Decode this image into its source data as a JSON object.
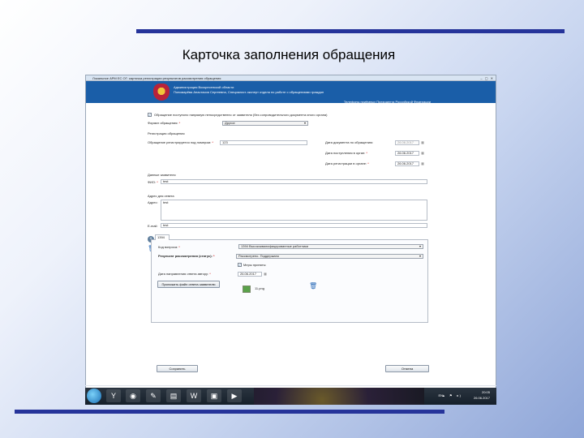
{
  "slide": {
    "title": "Карточка заполнения обращения"
  },
  "window": {
    "title": "Локальное АРМ ЕС ОГ: карточка регистрации результатов рассмотрения обращения",
    "controls": "–  ▢  ✕"
  },
  "header": {
    "org": "Администрация Воскресенской области",
    "user": "Пономарёва Анастасия Сергеевна, Специалист-эксперт отдела по работе с обращениями граждан",
    "link": "Телефоны приёмных Президента Российской Федерации"
  },
  "form": {
    "direct_checkbox_label": "Обращение поступило напрямую непосредственно от заявителя (без сопроводительного документа иного органа)",
    "format_label": "Формат обращения:",
    "format_value": "Другое",
    "registration_section": "Регистрация обращения",
    "reg_number_label": "Обращение регистрируется под номером:",
    "reg_number_value": "123",
    "doc_date_label": "Дата документа по обращению:",
    "doc_date_value": "26.06.2017",
    "received_date_label": "Дата поступления в орган:",
    "received_date_value": "26.06.2017",
    "registered_date_label": "Дата регистрации в органе:",
    "registered_date_value": "26.06.2017",
    "applicant_section": "Данные заявителя",
    "fio_label": "ФИО:",
    "fio_value": "test",
    "address_section": "Адрес для ответа",
    "address_label": "Адрес:",
    "address_value": "test",
    "email_label": "E-mail:",
    "email_value": "test"
  },
  "question": {
    "tab_label": "1394",
    "code_label": "Код вопроса:",
    "code_value": "1394 Высококвалифицированные работники",
    "result_label": "Результат рассмотрения (статус):",
    "result_value": "Рассмотрено. Поддержано",
    "measures_label": "Меры приняты",
    "answer_date_label": "Дата направления ответа автору:",
    "answer_date_value": "26.06.2017",
    "attach_button": "Приложить файл ответа заявителю",
    "file_name": "11.png"
  },
  "footer": {
    "save_button": "Сохранить",
    "cancel_button": "Отмена"
  },
  "taskbar": {
    "lang": "EN",
    "tray": "▲ ⚑ ◂)",
    "time": "20:05",
    "date": "26.06.2017"
  },
  "colors": {
    "slide_rule": "#26349a",
    "app_header": "#1a5ea8",
    "taskbar": "#16202a"
  },
  "icons": [
    "crest-icon",
    "checkmark-icon",
    "add-question-icon",
    "delete-question-icon",
    "trash-icon",
    "image-file-icon",
    "windows-start-icon"
  ]
}
